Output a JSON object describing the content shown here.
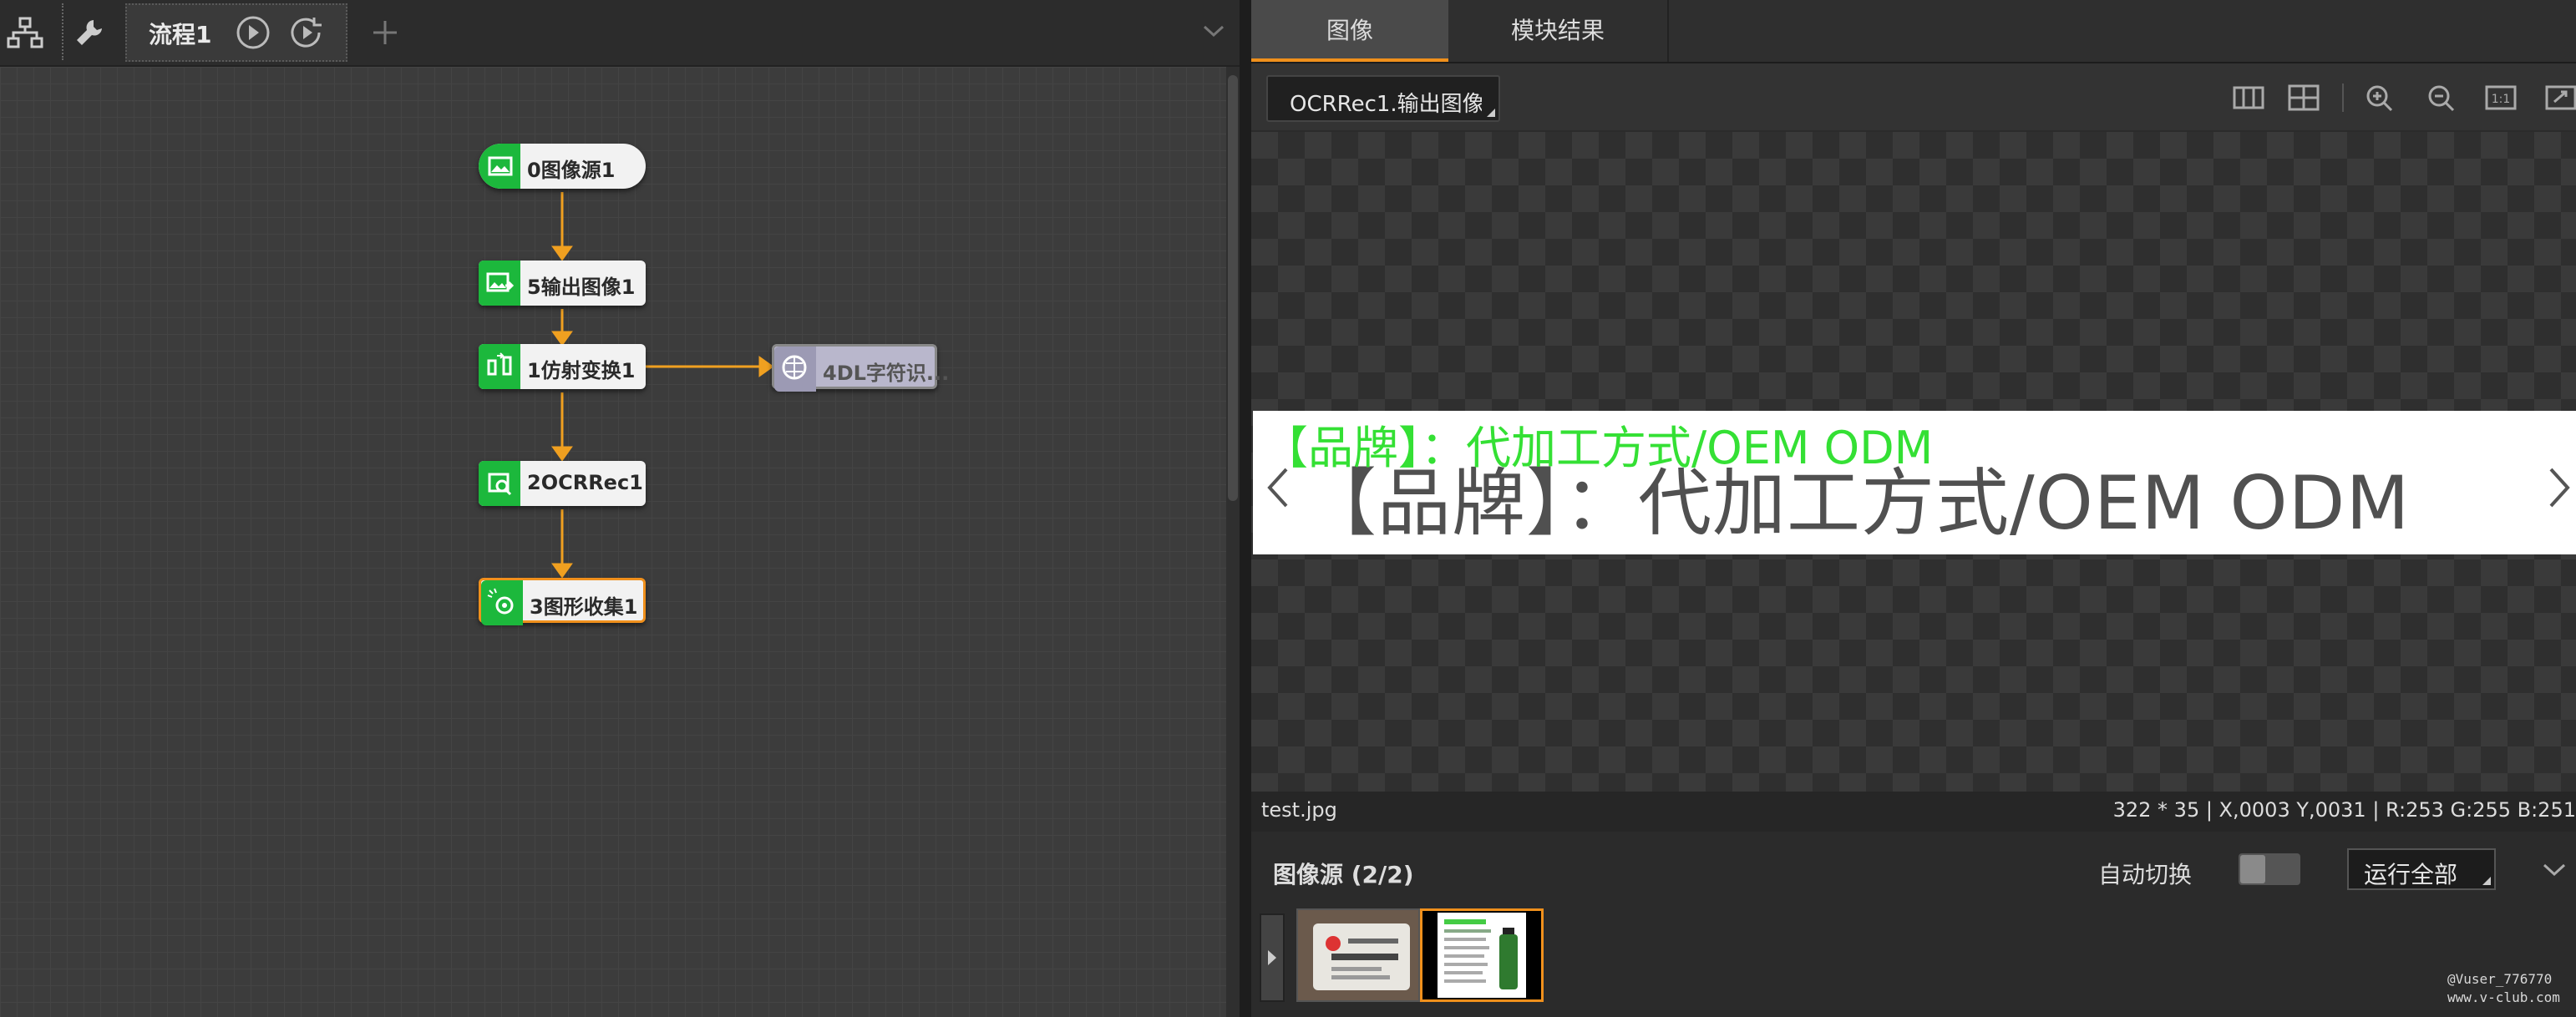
{
  "left_toolbar": {
    "flow_tab_label": "流程1"
  },
  "flow": {
    "nodes": [
      {
        "label": "0图像源1",
        "icon": "image-icon",
        "state": "normal"
      },
      {
        "label": "5输出图像1",
        "icon": "image-output-icon",
        "state": "normal"
      },
      {
        "label": "1仿射变换1",
        "icon": "affine-transform-icon",
        "state": "normal"
      },
      {
        "label": "4DL字符识...",
        "icon": "dl-recognition-icon",
        "state": "disabled"
      },
      {
        "label": "2OCRRec1",
        "icon": "ocr-search-icon",
        "state": "normal"
      },
      {
        "label": "3图形收集1",
        "icon": "shape-collect-icon",
        "state": "selected"
      }
    ]
  },
  "right_tabs": {
    "image": "图像",
    "results": "模块结果"
  },
  "viewer": {
    "image_select_value": "OCRRec1.输出图像",
    "image_text": "【品牌】：代加工方式/OEM ODM",
    "ocr_result": "【品牌】：代加工方式/OEM ODM"
  },
  "status": {
    "file": "test.jpg",
    "info": "322 * 35  |  X,0003  Y,0031  |  R:253  G:255  B:251"
  },
  "source": {
    "title": "图像源 (2/2)",
    "auto_switch_label": "自动切换",
    "auto_switch_on": false,
    "run_all_label": "运行全部"
  },
  "watermark": {
    "line1": "@Vuser_776770",
    "line2": "www.v-club.com"
  },
  "colors": {
    "accent": "#f0901c",
    "node_green": "#1cb83c",
    "ocr_green": "#34e034"
  }
}
